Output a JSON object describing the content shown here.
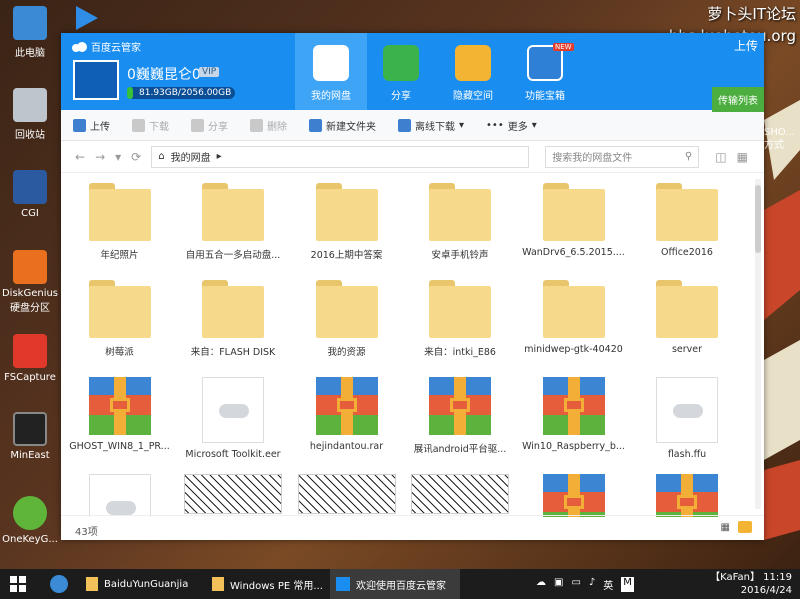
{
  "watermark": {
    "line1": "萝卜头IT论坛",
    "line2": "bbs.luobotou.org"
  },
  "desktop": {
    "icons": [
      {
        "label": "此电脑"
      },
      {
        "label": "回收站"
      },
      {
        "label": "CGI"
      },
      {
        "label": "DiskGenius",
        "label2": "硬盘分区"
      },
      {
        "label": "FSCapture"
      },
      {
        "label": "MinEast"
      },
      {
        "label": "OneKeyG..."
      }
    ],
    "side_text": {
      "line1": "SHO...",
      "line2": "方式"
    }
  },
  "app": {
    "title": "百度云管家",
    "username": "0巍巍昆仑0",
    "vip": "VIP",
    "quota": "81.93GB/2056.00GB",
    "quota_fraction": 0.04,
    "nav": [
      {
        "label": "我的网盘",
        "active": true
      },
      {
        "label": "分享"
      },
      {
        "label": "隐藏空间"
      },
      {
        "label": "功能宝箱",
        "badge": "NEW"
      }
    ],
    "window_controls": {
      "upload_header": "上传"
    },
    "transfer_list": "传输列表"
  },
  "toolbar": {
    "upload": "上传",
    "download": "下载",
    "share": "分享",
    "delete": "删除",
    "new_folder": "新建文件夹",
    "offline": "离线下载",
    "more": "更多"
  },
  "address": {
    "path": "我的网盘",
    "search_placeholder": "搜索我的网盘文件"
  },
  "files": [
    {
      "name": "年纪照片",
      "kind": "folder"
    },
    {
      "name": "自用五合一多启动盘...",
      "kind": "folder"
    },
    {
      "name": "2016上期中答案",
      "kind": "folder"
    },
    {
      "name": "安卓手机铃声",
      "kind": "folder"
    },
    {
      "name": "WanDrv6_6.5.2015....",
      "kind": "folder"
    },
    {
      "name": "Office2016",
      "kind": "folder"
    },
    {
      "name": "树莓派",
      "kind": "folder"
    },
    {
      "name": "来自：FLASH DISK",
      "kind": "folder"
    },
    {
      "name": "我的资源",
      "kind": "folder"
    },
    {
      "name": "来自：intki_E86",
      "kind": "folder"
    },
    {
      "name": "minidwep-gtk-40420",
      "kind": "folder"
    },
    {
      "name": "server",
      "kind": "folder"
    },
    {
      "name": "GHOST_WIN8_1_PR...",
      "kind": "archive"
    },
    {
      "name": "Microsoft Toolkit.eer",
      "kind": "doc"
    },
    {
      "name": "hejindantou.rar",
      "kind": "archive"
    },
    {
      "name": "展讯android平台驱...",
      "kind": "archive"
    },
    {
      "name": "Win10_Raspberry_b...",
      "kind": "archive"
    },
    {
      "name": "flash.ffu",
      "kind": "doc"
    },
    {
      "name": "",
      "kind": "doc"
    },
    {
      "name": "",
      "kind": "img"
    },
    {
      "name": "",
      "kind": "img"
    },
    {
      "name": "",
      "kind": "img"
    },
    {
      "name": "",
      "kind": "archive"
    },
    {
      "name": "",
      "kind": "archive"
    }
  ],
  "status": {
    "count": "43项"
  },
  "taskbar": {
    "tasks": [
      {
        "label": "BaiduYunGuanjia"
      },
      {
        "label": "Windows PE 常用..."
      },
      {
        "label": "欢迎使用百度云管家"
      }
    ],
    "ime": "英",
    "user": "【KaFan】",
    "time": "11:19",
    "date": "2016/4/24"
  }
}
